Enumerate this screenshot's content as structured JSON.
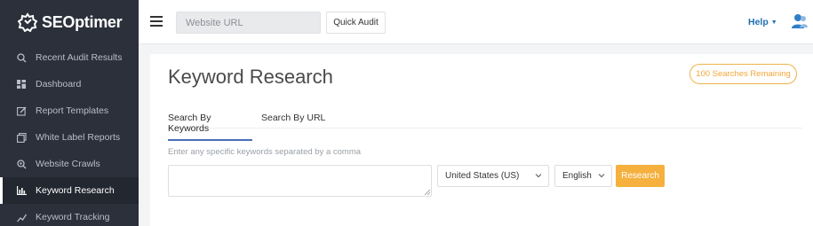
{
  "brand": {
    "name": "SEOptimer",
    "logo_icon": "gear-logo-icon"
  },
  "sidebar": {
    "items": [
      {
        "label": "Recent Audit Results",
        "icon": "search-icon"
      },
      {
        "label": "Dashboard",
        "icon": "dashboard-icon"
      },
      {
        "label": "Report Templates",
        "icon": "edit-icon"
      },
      {
        "label": "White Label Reports",
        "icon": "copy-icon"
      },
      {
        "label": "Website Crawls",
        "icon": "crawl-search-icon"
      },
      {
        "label": "Keyword Research",
        "icon": "bar-chart-icon",
        "active": true
      },
      {
        "label": "Keyword Tracking",
        "icon": "tracking-icon"
      }
    ]
  },
  "topbar": {
    "url_placeholder": "Website URL",
    "quick_audit_label": "Quick Audit",
    "help_label": "Help",
    "user_icon": "user-group-icon"
  },
  "main": {
    "title": "Keyword Research",
    "searches_remaining": "100 Searches Remaining",
    "tabs": [
      {
        "label": "Search By Keywords",
        "active": true
      },
      {
        "label": "Search By URL",
        "active": false
      }
    ],
    "hint": "Enter any specific keywords separated by a comma",
    "keyword_value": "",
    "country_selected": "United States (US)",
    "language_selected": "English",
    "research_label": "Research"
  },
  "colors": {
    "sidebar_bg": "#2b303b",
    "accent_orange": "#f5b03e",
    "link_blue": "#1e6fb3",
    "tab_underline": "#4a6fb8"
  }
}
